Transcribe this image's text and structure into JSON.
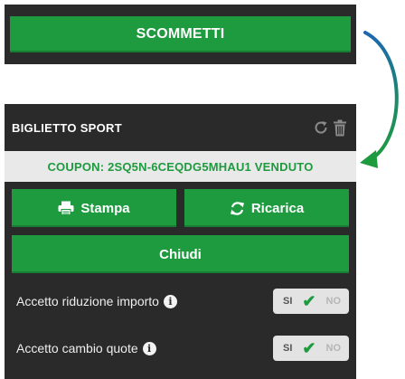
{
  "top": {
    "scommetti_label": "SCOMMETTI"
  },
  "ticket": {
    "title": "BIGLIETTO SPORT",
    "coupon_text": "COUPON: 2SQ5N-6CEQDG5MHAU1 VENDUTO",
    "buttons": {
      "stampa": "Stampa",
      "ricarica": "Ricarica",
      "chiudi": "Chiudi"
    },
    "options": [
      {
        "label": "Accetto riduzione importo",
        "on": "SI",
        "off": "NO",
        "value": "SI"
      },
      {
        "label": "Accetto cambio quote",
        "on": "SI",
        "off": "NO",
        "value": "SI"
      }
    ],
    "icons": {
      "refresh": "refresh-icon",
      "trash": "trash-icon",
      "print": "print-icon",
      "info": "info-icon",
      "check": "check-icon"
    }
  },
  "colors": {
    "green": "#1e9a3f",
    "panel_dark": "#2a2a2a",
    "coupon_bg": "#e9e9e9",
    "arrow": "#1f6fa8"
  }
}
